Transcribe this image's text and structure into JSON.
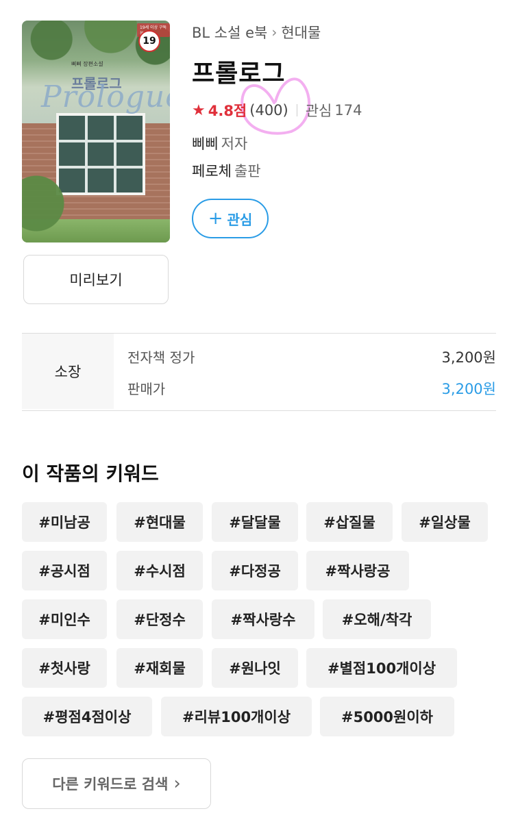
{
  "cover": {
    "age_rating": "19",
    "top_strip": "19세 이상 구독 불가",
    "author_small": "삐삐 장편소설",
    "korean_title": "프롤로그",
    "script_title": "Prologue"
  },
  "preview_label": "미리보기",
  "breadcrumb": {
    "category": "BL 소설 e북",
    "subcategory": "현대물"
  },
  "book": {
    "title": "프롤로그",
    "rating": "4.8점",
    "rating_count": "(400)",
    "wish_label": "관심",
    "wish_count": "174",
    "author": "삐삐",
    "author_role": "저자",
    "publisher": "페로체",
    "publisher_role": "출판"
  },
  "wish_button_label": "관심",
  "price": {
    "section_label": "소장",
    "list_label": "전자책 정가",
    "list_value": "3,200원",
    "sale_label": "판매가",
    "sale_value": "3,200원"
  },
  "keywords": {
    "heading": "이 작품의 키워드",
    "tags": [
      "#미남공",
      "#현대물",
      "#달달물",
      "#삽질물",
      "#일상물",
      "#공시점",
      "#수시점",
      "#다정공",
      "#짝사랑공",
      "#미인수",
      "#단정수",
      "#짝사랑수",
      "#오해/착각",
      "#첫사랑",
      "#재회물",
      "#원나잇",
      "#별점100개이상",
      "#평점4점이상",
      "#리뷰100개이상",
      "#5000원이하"
    ],
    "search_label": "다른 키워드로 검색"
  },
  "colors": {
    "accent": "#2a9ce6",
    "rating": "#e0303b",
    "tag_bg": "#f2f2f2"
  },
  "icons": {
    "star": "star-icon",
    "chevron": "chevron-right-icon",
    "plus": "plus-icon"
  }
}
